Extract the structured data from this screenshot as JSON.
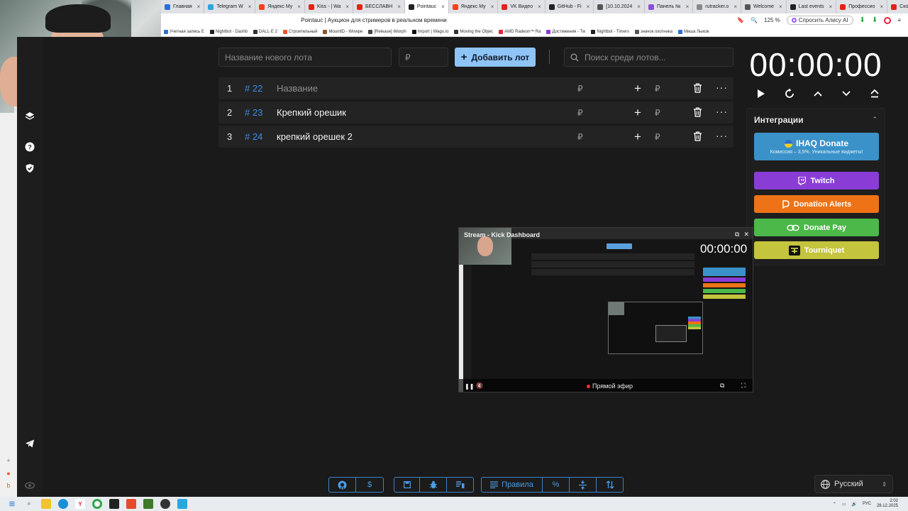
{
  "browser": {
    "tabs": [
      {
        "label": "Главная",
        "color": "#2e6fd6",
        "active": false
      },
      {
        "label": "Telegram W",
        "color": "#2ea6de",
        "active": false
      },
      {
        "label": "Яндекс Му",
        "color": "#fc3f1d",
        "active": false
      },
      {
        "label": "Kiss - | Wa",
        "color": "#e62117",
        "active": false
      },
      {
        "label": "БЕССЛАВН",
        "color": "#e62117",
        "active": false
      },
      {
        "label": "Pointauc",
        "color": "#222222",
        "active": true
      },
      {
        "label": "Яндекс Му",
        "color": "#fc3f1d",
        "active": false
      },
      {
        "label": "VK Видео",
        "color": "#e62117",
        "active": false
      },
      {
        "label": "GitHub - Fi",
        "color": "#222222",
        "active": false
      },
      {
        "label": "[10.10.2024",
        "color": "#555555",
        "active": false
      },
      {
        "label": "Панель №",
        "color": "#8a4fd6",
        "active": false
      },
      {
        "label": "rutracker.o",
        "color": "#888888",
        "active": false
      },
      {
        "label": "Welcome",
        "color": "#555555",
        "active": false
      },
      {
        "label": "Last events",
        "color": "#222222",
        "active": false
      },
      {
        "label": "Профессио",
        "color": "#e62117",
        "active": false
      },
      {
        "label": "Скотт Эдв",
        "color": "#e62117",
        "active": false
      }
    ],
    "page_title": "Pointauc | Аукцион для стримеров в реальном времени",
    "zoom": "125 %",
    "alice_label": "Спросить Алису AI",
    "bookmarks": [
      "Учетная запись E",
      "Nightbot - Dashb",
      "DALL·E 2",
      "Строительный",
      "MountID - Wowpe",
      "[Release] iMorph",
      "Import | Wago.io",
      "Moving the Objec",
      "AMD Radeon™ Ra",
      "Достижения - Tw",
      "Nightbot - Timers",
      "значок охотника",
      "Миша Лыков"
    ]
  },
  "form": {
    "lot_name_placeholder": "Название нового лота",
    "price_placeholder": "₽",
    "add_label": "Добавить лот",
    "search_placeholder": "Поиск среди лотов..."
  },
  "lots": [
    {
      "index": "1",
      "id": "# 22",
      "name": "Название",
      "rub": "₽",
      "rub2": "₽"
    },
    {
      "index": "2",
      "id": "# 23",
      "name": "Крепкий орешик",
      "rub": "₽",
      "rub2": "₽"
    },
    {
      "index": "3",
      "id": "# 24",
      "name": " крепкий орешек 2",
      "rub": "₽",
      "rub2": "₽"
    }
  ],
  "timer": {
    "value": "00:00:00"
  },
  "integrations": {
    "title": "Интеграции",
    "ihaq_title": "IHAQ Donate",
    "ihaq_sub": "Комиссия – 3,5%. Уникальные виджеты!",
    "twitch": "Twitch",
    "donation_alerts": "Donation Alerts",
    "donate_pay": "Donate Pay",
    "tourniquet": "Tourniquet",
    "colors": {
      "ihaq": "#3a92c9",
      "twitch": "#8a3dd6",
      "donation_alerts": "#ee7316",
      "donate_pay": "#4cb84a",
      "tourniquet": "#c4c43d"
    }
  },
  "popup": {
    "title": "Stream - Kick Dashboard",
    "timer": "00:00:00",
    "live_label": "Прямой эфир"
  },
  "toolbar": {
    "rules_label": "Правила",
    "percent_label": "%",
    "dollar_label": "$"
  },
  "language": {
    "selected": "Русский"
  },
  "taskbar": {
    "lang": "РУС",
    "time": "2:02",
    "date": "28.12.2025"
  },
  "accent": "#8fc4f7"
}
